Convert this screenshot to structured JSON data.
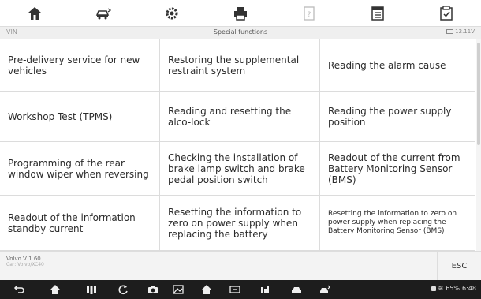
{
  "toolbar": {
    "buttons": [
      {
        "icon": "home-icon"
      },
      {
        "icon": "vehicle-swap-icon"
      },
      {
        "icon": "settings-icon"
      },
      {
        "icon": "print-icon"
      },
      {
        "icon": "help-icon"
      },
      {
        "icon": "data-log-icon"
      },
      {
        "icon": "save-icon"
      }
    ]
  },
  "titlebar": {
    "vin": "VIN",
    "title": "Special functions",
    "voltage": "12.11V"
  },
  "functions": [
    {
      "label": "Pre-delivery service for new vehicles"
    },
    {
      "label": "Restoring the supplemental restraint system"
    },
    {
      "label": "Reading the alarm cause"
    },
    {
      "label": "Workshop Test (TPMS)"
    },
    {
      "label": "Reading and resetting the alco-lock"
    },
    {
      "label": "Reading the power supply position"
    },
    {
      "label": "Programming of the rear window wiper when reversing"
    },
    {
      "label": "Checking the installation of brake lamp switch and brake pedal position switch"
    },
    {
      "label": "Readout of the current from Battery Monitoring Sensor (BMS)"
    },
    {
      "label": "Readout of the information standby current"
    },
    {
      "label": "Resetting the information to zero on power supply when replacing the battery"
    },
    {
      "label": "Resetting the information to zero on power supply when replacing the Battery Monitoring Sensor (BMS)"
    }
  ],
  "footer": {
    "vehicle": "Volvo V 1.60",
    "sub": "Car: Volvo/XC40",
    "esc_label": "ESC"
  },
  "statusbar": {
    "battery": "65%",
    "time": "6:48"
  }
}
